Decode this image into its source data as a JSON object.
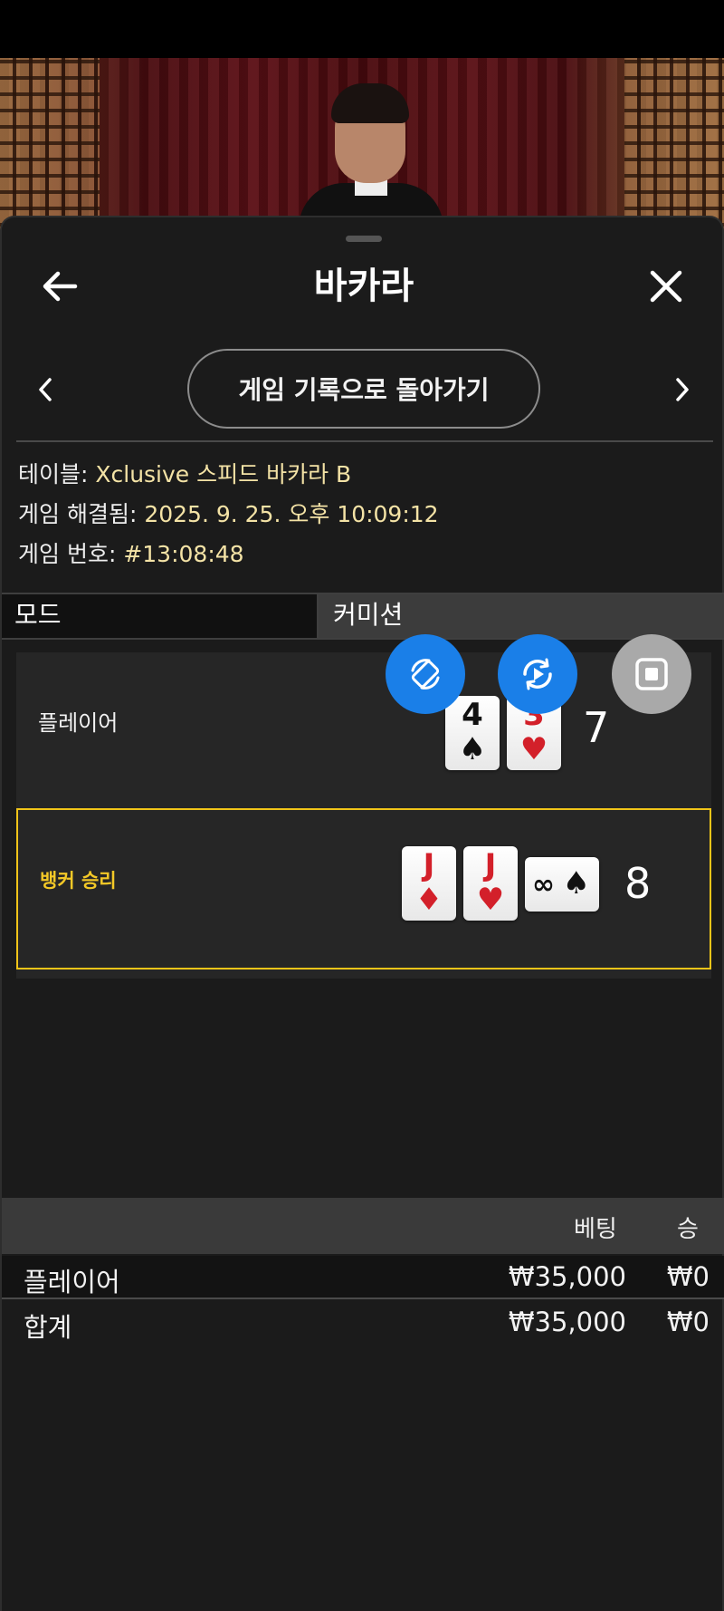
{
  "header": {
    "title": "바카라"
  },
  "navigation": {
    "back_to_history_label": "게임 기록으로 돌아가기"
  },
  "game_info": {
    "table_label": "테이블: ",
    "table_value": "Xclusive 스피드 바카라 B",
    "resolved_label": "게임 해결됨: ",
    "resolved_value": "2025. 9. 25. 오후 10:09:12",
    "game_id_label": "게임 번호: ",
    "game_id_value": "#13:08:48"
  },
  "mode": {
    "mode_label": "모드",
    "commission_label": "커미션"
  },
  "result": {
    "player": {
      "label": "플레이어",
      "total": "7",
      "cards": [
        {
          "rank": "4",
          "suit": "♠",
          "color": "black"
        },
        {
          "rank": "3",
          "suit": "♥",
          "color": "red"
        }
      ]
    },
    "banker": {
      "label": "뱅커 승리",
      "total": "8",
      "cards": [
        {
          "rank": "J",
          "suit": "♦",
          "color": "red"
        },
        {
          "rank": "J",
          "suit": "♥",
          "color": "red"
        },
        {
          "rank": "∞",
          "suit": "♠",
          "color": "black"
        }
      ]
    }
  },
  "bets": {
    "headers": {
      "bet": "베팅",
      "win": "승"
    },
    "rows": [
      {
        "name": "플레이어",
        "amount": "₩35,000",
        "win": "₩0"
      }
    ],
    "total": {
      "name": "합계",
      "amount": "₩35,000",
      "win": "₩0"
    }
  },
  "icons": {
    "back": "arrow-left-icon",
    "close": "close-icon",
    "prev": "chevron-left-icon",
    "next": "chevron-right-icon",
    "rotate": "rotate-screen-icon",
    "replay": "replay-icon",
    "stop": "stop-icon"
  },
  "colors": {
    "accent_yellow": "#f0c419",
    "info_value": "#f4e3a6",
    "fab_blue": "#1a7fe8",
    "fab_gray": "#a9a9a9",
    "background": "#1b1b1b"
  }
}
